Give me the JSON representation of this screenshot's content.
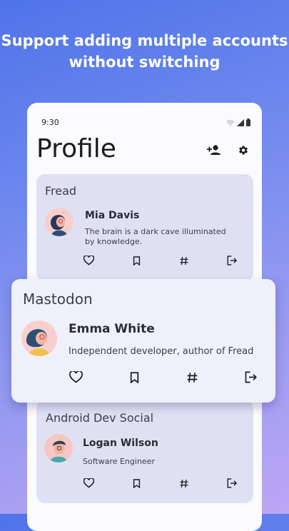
{
  "headline": {
    "line1": "Support adding multiple accounts",
    "line2": "without switching"
  },
  "status_bar": {
    "time": "9:30",
    "icons": [
      "wifi-icon",
      "signal-icon",
      "battery-icon"
    ]
  },
  "profile": {
    "title": "Profile",
    "actions": [
      "add-account-icon",
      "settings-icon"
    ]
  },
  "accounts": [
    {
      "server": "Fread",
      "name": "Mia Davis",
      "bio": [
        "The brain is a dark cave illuminated",
        "by knowledge."
      ]
    },
    {
      "server": "Mastodon",
      "name": "Emma White",
      "bio": [
        "Independent developer, author of Fread"
      ]
    },
    {
      "server": "Android Dev Social",
      "name": "Logan Wilson",
      "bio": [
        "Software Engineer"
      ]
    }
  ],
  "card_actions": [
    "favorite-icon",
    "bookmark-icon",
    "hashtag-icon",
    "logout-icon"
  ],
  "colors": {
    "accent_blue": "#4f73e9",
    "card_background": "#dfe1f3",
    "front_card_background": "#eff0fc"
  }
}
